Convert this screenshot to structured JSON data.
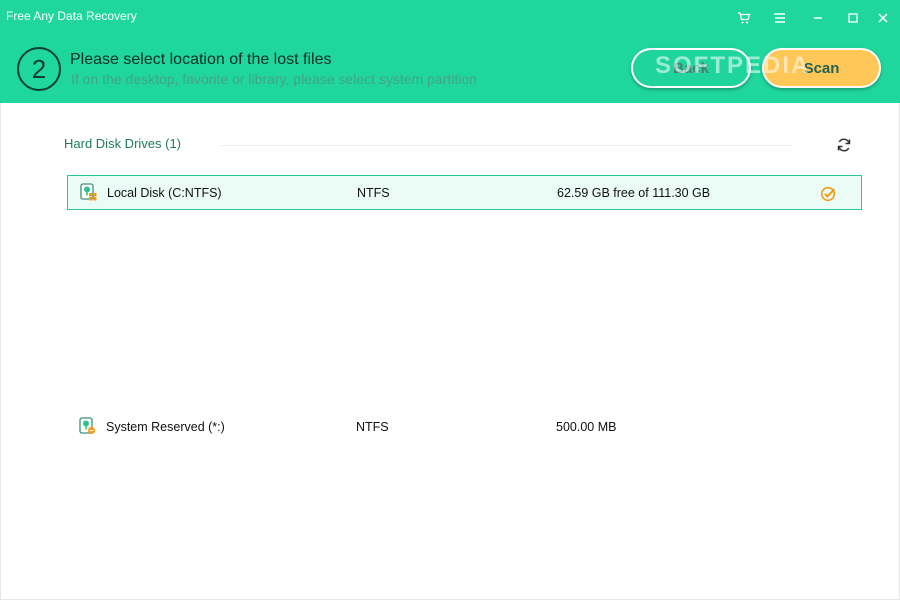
{
  "window": {
    "title": "Free Any Data Recovery",
    "controls": [
      "cart-icon",
      "menu-icon",
      "minimize-icon",
      "maximize-icon",
      "close-icon"
    ]
  },
  "header": {
    "step_number": "2",
    "title": "Please select location of the lost files",
    "subtitle": "If on the desktop, favorite or library, please select system partition",
    "back_label": "Back",
    "scan_label": "Scan",
    "watermark": "SOFTPEDIA"
  },
  "colors": {
    "header_bg": "#1fd69c",
    "scan_button": "#ffc757",
    "accent_orange": "#f39a1a",
    "selected_row_bg": "#eafcf5",
    "selected_row_border": "#28c992"
  },
  "section": {
    "title": "Hard Disk Drives (1)",
    "refresh_icon": "refresh-icon"
  },
  "drives": [
    {
      "name": "Local Disk (C:NTFS)",
      "fs": "NTFS",
      "size": "62.59 GB free of 111.30 GB",
      "selected": true,
      "icon": "drive-windows-icon"
    },
    {
      "name": "System Reserved (*:)",
      "fs": "NTFS",
      "size": "500.00 MB",
      "selected": false,
      "icon": "drive-reserved-icon"
    }
  ]
}
